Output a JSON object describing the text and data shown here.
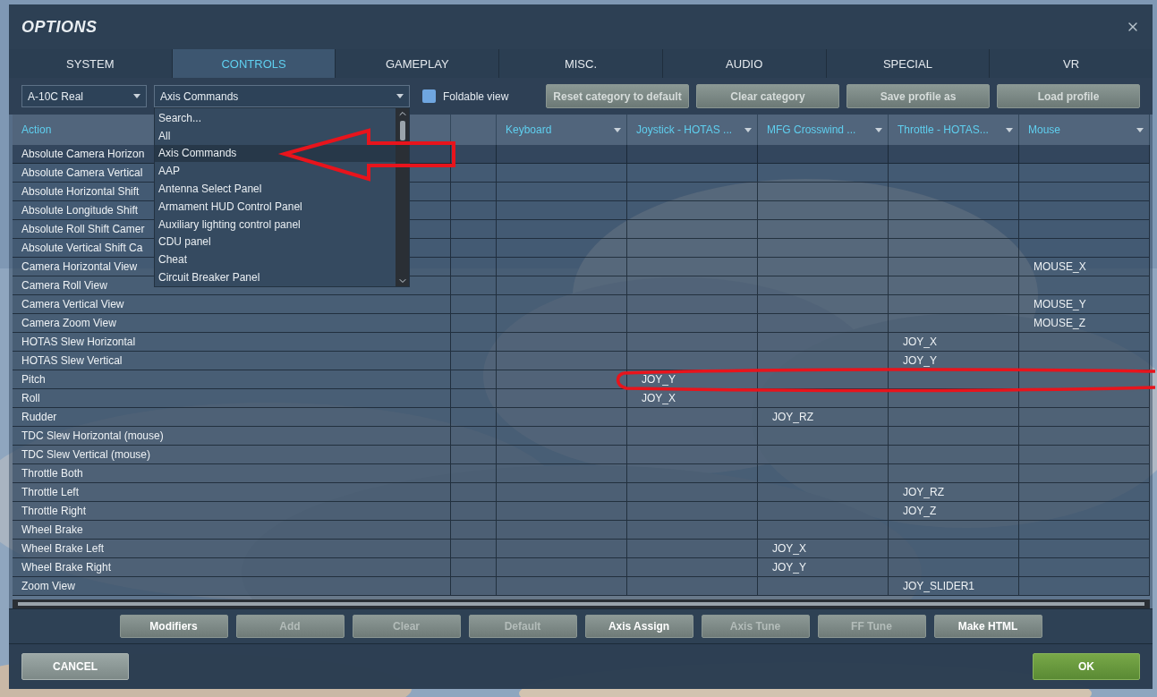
{
  "window": {
    "title": "OPTIONS"
  },
  "tabs": [
    {
      "label": "SYSTEM",
      "selected": false
    },
    {
      "label": "CONTROLS",
      "selected": true
    },
    {
      "label": "GAMEPLAY",
      "selected": false
    },
    {
      "label": "MISC.",
      "selected": false
    },
    {
      "label": "AUDIO",
      "selected": false
    },
    {
      "label": "SPECIAL",
      "selected": false
    },
    {
      "label": "VR",
      "selected": false
    }
  ],
  "toolbar": {
    "aircraft": "A-10C Real",
    "category": "Axis Commands",
    "foldable_view": {
      "label": "Foldable view",
      "checked": false
    },
    "buttons": [
      "Reset category to default",
      "Clear category",
      "Save profile as",
      "Load profile"
    ]
  },
  "category_list": [
    {
      "label": "Search...",
      "selected": false
    },
    {
      "label": "All",
      "selected": false
    },
    {
      "label": "Axis Commands",
      "selected": true
    },
    {
      "label": "AAP",
      "selected": false
    },
    {
      "label": "Antenna Select Panel",
      "selected": false
    },
    {
      "label": "Armament HUD Control Panel",
      "selected": false
    },
    {
      "label": "Auxiliary lighting control panel",
      "selected": false
    },
    {
      "label": "CDU panel",
      "selected": false
    },
    {
      "label": "Cheat",
      "selected": false
    },
    {
      "label": "Circuit Breaker Panel",
      "selected": false
    }
  ],
  "table": {
    "columns": [
      {
        "kind": "action",
        "label": "Action"
      },
      {
        "kind": "spacer"
      },
      {
        "kind": "device",
        "label": "Keyboard"
      },
      {
        "kind": "device",
        "label": "Joystick - HOTAS ..."
      },
      {
        "kind": "device",
        "label": "MFG Crosswind ..."
      },
      {
        "kind": "device",
        "label": "Throttle - HOTAS..."
      },
      {
        "kind": "device",
        "label": "Mouse"
      }
    ],
    "rows": [
      {
        "action": "Absolute Camera Horizon",
        "selected": true
      },
      {
        "action": "Absolute Camera Vertical",
        "selected": false
      },
      {
        "action": "Absolute Horizontal Shift",
        "selected": false
      },
      {
        "action": "Absolute Longitude Shift",
        "selected": false
      },
      {
        "action": "Absolute Roll Shift Camer",
        "selected": false
      },
      {
        "action": "Absolute Vertical Shift Ca",
        "selected": false
      },
      {
        "action": "Camera Horizontal View",
        "selected": false,
        "mouse": "MOUSE_X"
      },
      {
        "action": "Camera Roll View",
        "selected": false
      },
      {
        "action": "Camera Vertical View",
        "selected": false,
        "mouse": "MOUSE_Y"
      },
      {
        "action": "Camera Zoom View",
        "selected": false,
        "mouse": "MOUSE_Z"
      },
      {
        "action": "HOTAS Slew Horizontal",
        "selected": false,
        "throttle": "JOY_X"
      },
      {
        "action": "HOTAS Slew Vertical",
        "selected": false,
        "throttle": "JOY_Y"
      },
      {
        "action": "Pitch",
        "selected": false,
        "joystick": "JOY_Y"
      },
      {
        "action": "Roll",
        "selected": false,
        "joystick": "JOY_X"
      },
      {
        "action": "Rudder",
        "selected": false,
        "rudder": "JOY_RZ"
      },
      {
        "action": "TDC Slew Horizontal (mouse)",
        "selected": false
      },
      {
        "action": "TDC Slew Vertical (mouse)",
        "selected": false
      },
      {
        "action": "Throttle Both",
        "selected": false
      },
      {
        "action": "Throttle Left",
        "selected": false,
        "throttle": "JOY_RZ"
      },
      {
        "action": "Throttle Right",
        "selected": false,
        "throttle": "JOY_Z"
      },
      {
        "action": "Wheel Brake",
        "selected": false
      },
      {
        "action": "Wheel Brake Left",
        "selected": false,
        "rudder": "JOY_X"
      },
      {
        "action": "Wheel Brake Right",
        "selected": false,
        "rudder": "JOY_Y"
      },
      {
        "action": "Zoom View",
        "selected": false,
        "throttle": "JOY_SLIDER1"
      }
    ]
  },
  "annotations": {
    "arrow": true,
    "ellipse": true
  },
  "action_buttons": [
    {
      "label": "Modifiers",
      "disabled": false
    },
    {
      "label": "Add",
      "disabled": true
    },
    {
      "label": "Clear",
      "disabled": true
    },
    {
      "label": "Default",
      "disabled": true
    },
    {
      "label": "Axis Assign",
      "disabled": false
    },
    {
      "label": "Axis Tune",
      "disabled": true
    },
    {
      "label": "FF Tune",
      "disabled": true
    },
    {
      "label": "Make HTML",
      "disabled": false
    }
  ],
  "footer": {
    "cancel": "CANCEL",
    "ok": "OK"
  }
}
